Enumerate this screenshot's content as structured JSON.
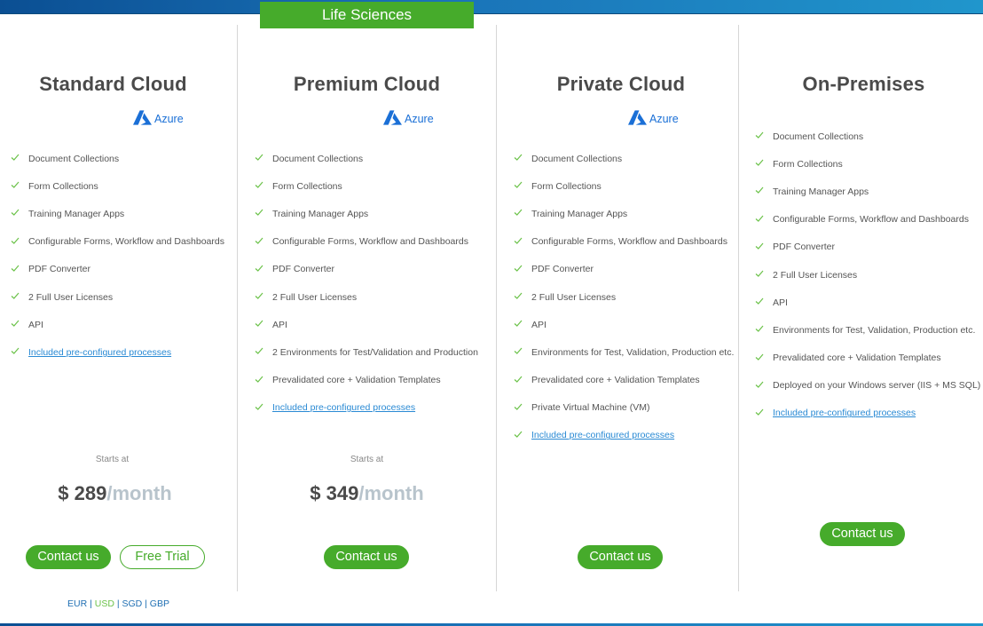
{
  "banner": {
    "label": "Life Sciences"
  },
  "colors": {
    "accent_green": "#46ab2b",
    "check_green": "#6cc24a",
    "link_blue": "#2a8ad4",
    "header_blue": "#1a73b8"
  },
  "plans": [
    {
      "title": "Standard Cloud",
      "provider": {
        "icon": "azure-logo-icon",
        "label": "Azure"
      },
      "features": [
        "Document Collections",
        "Form Collections",
        "Training Manager Apps",
        "Configurable Forms, Workflow and Dashboards",
        "PDF Converter",
        "2 Full User Licenses",
        "API"
      ],
      "link": "Included pre-configured processes",
      "starts_at": "Starts at",
      "price": "$ 289",
      "period": "/month",
      "buttons": {
        "contact": "Contact us",
        "trial": "Free Trial"
      }
    },
    {
      "title": "Premium Cloud",
      "provider": {
        "icon": "azure-logo-icon",
        "label": "Azure"
      },
      "features": [
        "Document Collections",
        "Form Collections",
        "Training Manager Apps",
        "Configurable Forms, Workflow and Dashboards",
        "PDF Converter",
        "2 Full User Licenses",
        "API",
        " 2 Environments for Test/Validation and Production",
        "Prevalidated core + Validation Templates"
      ],
      "link": "Included pre-configured processes",
      "starts_at": "Starts at",
      "price": "$ 349",
      "period": "/month",
      "buttons": {
        "contact": "Contact us"
      }
    },
    {
      "title": "Private Cloud",
      "provider": {
        "icon": "azure-logo-icon",
        "label": "Azure"
      },
      "features": [
        "Document Collections",
        "Form Collections",
        "Training Manager Apps",
        "Configurable Forms, Workflow and Dashboards",
        "PDF Converter",
        "2 Full User Licenses",
        "API",
        "Environments for Test, Validation, Production etc.",
        "Prevalidated core + Validation Templates",
        "Private Virtual Machine (VM)"
      ],
      "link": "Included pre-configured processes",
      "buttons": {
        "contact": "Contact us"
      }
    },
    {
      "title": "On-Premises",
      "features": [
        "Document Collections",
        "Form Collections",
        "Training Manager Apps",
        "Configurable Forms, Workflow and Dashboards",
        "PDF Converter",
        "2 Full User Licenses",
        "API",
        "Environments for Test, Validation, Production etc.",
        "Prevalidated core + Validation Templates",
        "Deployed on your Windows server (IIS + MS SQL)"
      ],
      "link": "Included pre-configured processes",
      "buttons": {
        "contact": "Contact us"
      }
    }
  ],
  "currencies": {
    "items": [
      "EUR",
      "USD",
      "SGD",
      "GBP"
    ],
    "selected": "USD",
    "separator": "|"
  }
}
